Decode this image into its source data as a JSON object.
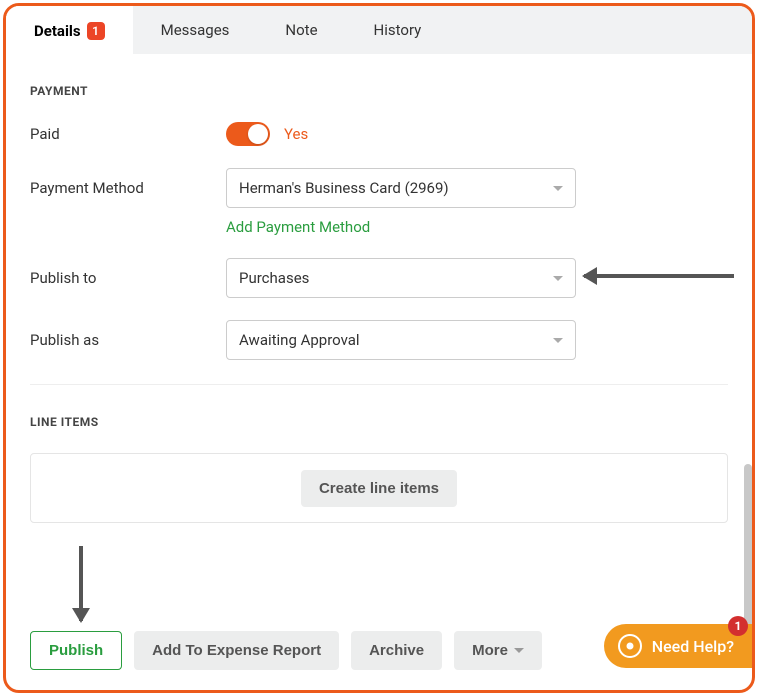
{
  "tabs": {
    "details": {
      "label": "Details",
      "badge": "1"
    },
    "messages": {
      "label": "Messages"
    },
    "note": {
      "label": "Note"
    },
    "history": {
      "label": "History"
    }
  },
  "sections": {
    "payment": {
      "heading": "PAYMENT"
    },
    "line_items": {
      "heading": "LINE ITEMS"
    }
  },
  "fields": {
    "paid": {
      "label": "Paid",
      "value_text": "Yes"
    },
    "payment_method": {
      "label": "Payment Method",
      "value": "Herman's Business Card (2969)",
      "add_link": "Add Payment Method"
    },
    "publish_to": {
      "label": "Publish to",
      "value": "Purchases"
    },
    "publish_as": {
      "label": "Publish as",
      "value": "Awaiting Approval"
    }
  },
  "buttons": {
    "create_line_items": "Create line items",
    "publish": "Publish",
    "add_expense": "Add To Expense Report",
    "archive": "Archive",
    "more": "More"
  },
  "help": {
    "label": "Need Help?",
    "badge": "1"
  }
}
